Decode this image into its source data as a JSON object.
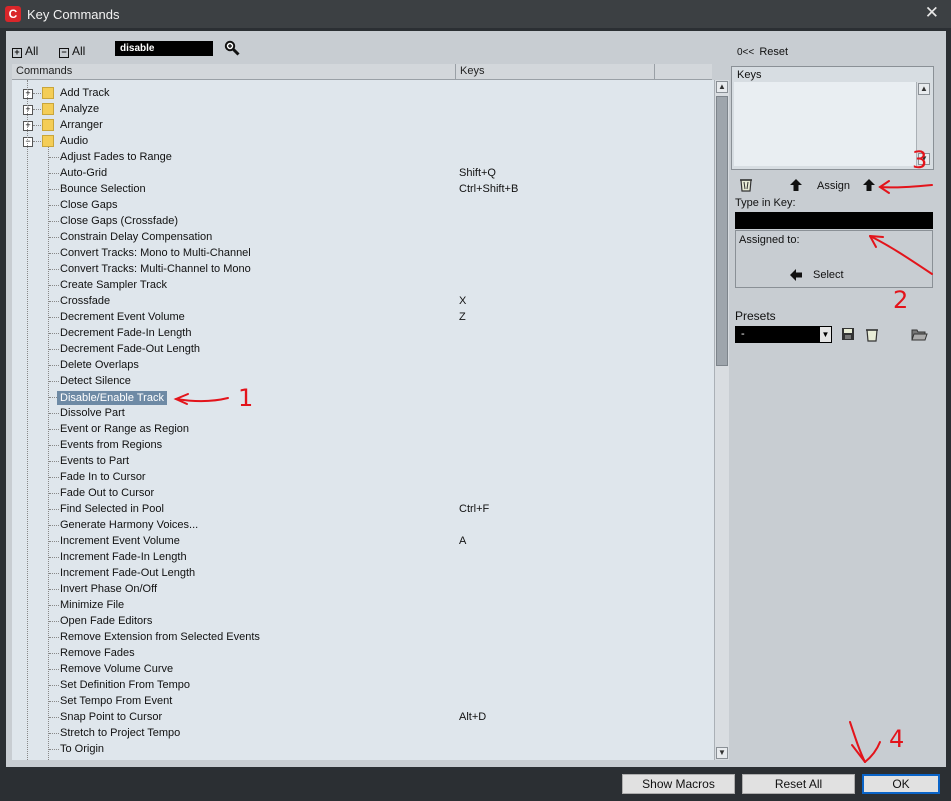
{
  "window": {
    "title": "Key Commands",
    "close_glyph": "✕",
    "app_icon": "cubase-icon"
  },
  "toolbar": {
    "expand_all_label": "All",
    "collapse_all_label": "All",
    "search_value": "disable"
  },
  "columns": {
    "commands": "Commands",
    "keys": "Keys"
  },
  "tree": [
    {
      "label": "Add Track",
      "type": "folder",
      "expanded": false,
      "key": ""
    },
    {
      "label": "Analyze",
      "type": "folder",
      "expanded": false,
      "key": ""
    },
    {
      "label": "Arranger",
      "type": "folder",
      "expanded": false,
      "key": ""
    },
    {
      "label": "Audio",
      "type": "folder",
      "expanded": true,
      "key": ""
    },
    {
      "label": "Adjust Fades to Range",
      "type": "item",
      "key": ""
    },
    {
      "label": "Auto-Grid",
      "type": "item",
      "key": "Shift+Q"
    },
    {
      "label": "Bounce Selection",
      "type": "item",
      "key": "Ctrl+Shift+B"
    },
    {
      "label": "Close Gaps",
      "type": "item",
      "key": ""
    },
    {
      "label": "Close Gaps (Crossfade)",
      "type": "item",
      "key": ""
    },
    {
      "label": "Constrain Delay Compensation",
      "type": "item",
      "key": ""
    },
    {
      "label": "Convert Tracks: Mono to Multi-Channel",
      "type": "item",
      "key": ""
    },
    {
      "label": "Convert Tracks: Multi-Channel to Mono",
      "type": "item",
      "key": ""
    },
    {
      "label": "Create Sampler Track",
      "type": "item",
      "key": ""
    },
    {
      "label": "Crossfade",
      "type": "item",
      "key": "X"
    },
    {
      "label": "Decrement Event Volume",
      "type": "item",
      "key": "Z"
    },
    {
      "label": "Decrement Fade-In Length",
      "type": "item",
      "key": ""
    },
    {
      "label": "Decrement Fade-Out Length",
      "type": "item",
      "key": ""
    },
    {
      "label": "Delete Overlaps",
      "type": "item",
      "key": ""
    },
    {
      "label": "Detect Silence",
      "type": "item",
      "key": ""
    },
    {
      "label": "Disable/Enable Track",
      "type": "item",
      "key": "",
      "selected": true
    },
    {
      "label": "Dissolve Part",
      "type": "item",
      "key": ""
    },
    {
      "label": "Event or Range as Region",
      "type": "item",
      "key": ""
    },
    {
      "label": "Events from Regions",
      "type": "item",
      "key": ""
    },
    {
      "label": "Events to Part",
      "type": "item",
      "key": ""
    },
    {
      "label": "Fade In to Cursor",
      "type": "item",
      "key": ""
    },
    {
      "label": "Fade Out to Cursor",
      "type": "item",
      "key": ""
    },
    {
      "label": "Find Selected in Pool",
      "type": "item",
      "key": "Ctrl+F"
    },
    {
      "label": "Generate Harmony Voices...",
      "type": "item",
      "key": ""
    },
    {
      "label": "Increment Event Volume",
      "type": "item",
      "key": "A"
    },
    {
      "label": "Increment Fade-In Length",
      "type": "item",
      "key": ""
    },
    {
      "label": "Increment Fade-Out Length",
      "type": "item",
      "key": ""
    },
    {
      "label": "Invert Phase On/Off",
      "type": "item",
      "key": ""
    },
    {
      "label": "Minimize File",
      "type": "item",
      "key": ""
    },
    {
      "label": "Open Fade Editors",
      "type": "item",
      "key": ""
    },
    {
      "label": "Remove Extension from Selected Events",
      "type": "item",
      "key": ""
    },
    {
      "label": "Remove Fades",
      "type": "item",
      "key": ""
    },
    {
      "label": "Remove Volume Curve",
      "type": "item",
      "key": ""
    },
    {
      "label": "Set Definition From Tempo",
      "type": "item",
      "key": ""
    },
    {
      "label": "Set Tempo From Event",
      "type": "item",
      "key": ""
    },
    {
      "label": "Snap Point to Cursor",
      "type": "item",
      "key": "Alt+D"
    },
    {
      "label": "Stretch to Project Tempo",
      "type": "item",
      "key": ""
    },
    {
      "label": "To Origin",
      "type": "item",
      "key": ""
    }
  ],
  "right_panel": {
    "reset_label": "Reset",
    "reset_prefix": "0<<",
    "keys_box_header": "Keys",
    "assign_label": "Assign",
    "type_in_key_label": "Type in Key:",
    "assigned_to_label": "Assigned to:",
    "select_label": "Select",
    "presets_label": "Presets",
    "preset_value": "-"
  },
  "footer": {
    "show_macros": "Show Macros",
    "reset_all": "Reset All",
    "ok": "OK"
  },
  "annotations": {
    "mark1": "1",
    "mark2": "2",
    "mark3": "3",
    "mark4": "4",
    "color": "#e3141b"
  },
  "colors": {
    "selected_row": "#6e8aa5",
    "list_bg": "#dfe6ec",
    "panel_bg": "#c8cdd2"
  }
}
